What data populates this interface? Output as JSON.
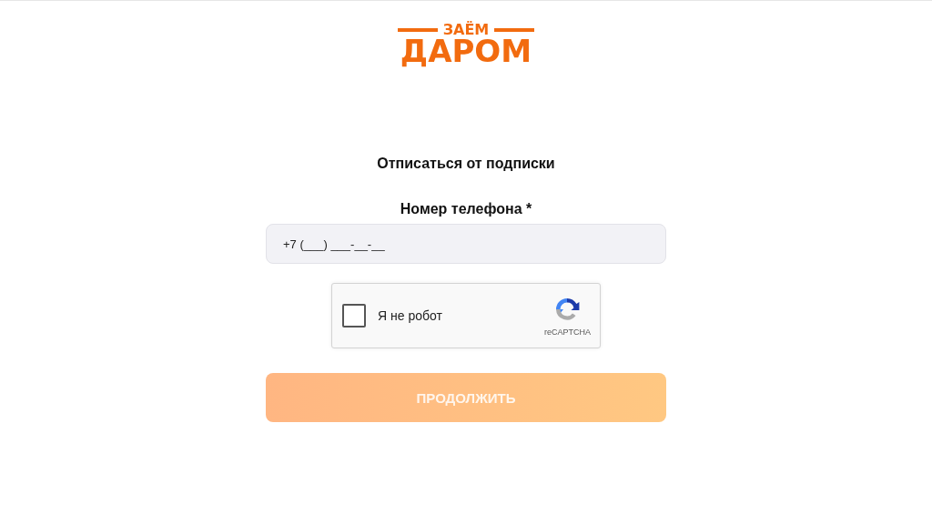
{
  "logo": {
    "top": "ЗАЁМ",
    "bottom": "ДАРОМ"
  },
  "title": "Отписаться от подписки",
  "phone": {
    "label": "Номер телефона *",
    "value": "+7 (___) ___-__-__"
  },
  "captcha": {
    "label": "Я не робот",
    "checked": false,
    "brand": "reCAPTCHA"
  },
  "submit": {
    "label": "ПРОДОЛЖИТЬ",
    "disabled": true
  }
}
